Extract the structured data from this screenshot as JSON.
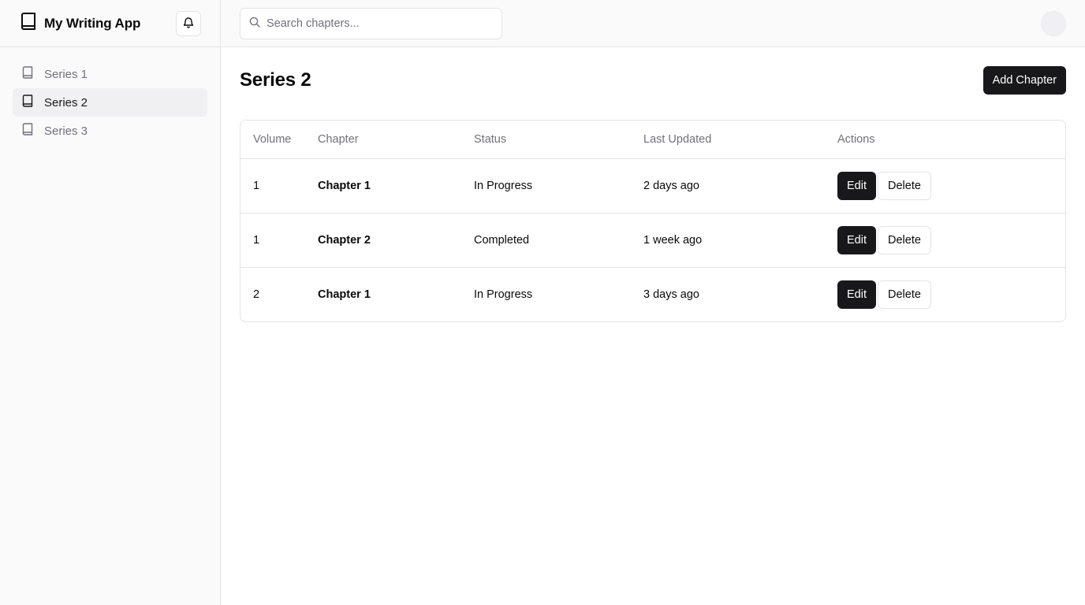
{
  "app": {
    "title": "My Writing App",
    "logo_icon": "book-icon",
    "notification_icon": "bell-icon"
  },
  "sidebar": {
    "items": [
      {
        "label": "Series 1",
        "icon": "book-icon",
        "active": false
      },
      {
        "label": "Series 2",
        "icon": "book-icon",
        "active": true
      },
      {
        "label": "Series 3",
        "icon": "book-icon",
        "active": false
      }
    ]
  },
  "search": {
    "placeholder": "Search chapters...",
    "value": "",
    "icon": "search-icon"
  },
  "main": {
    "title": "Series 2",
    "add_button": "Add Chapter"
  },
  "table": {
    "headers": {
      "volume": "Volume",
      "chapter": "Chapter",
      "status": "Status",
      "updated": "Last Updated",
      "actions": "Actions"
    },
    "rows": [
      {
        "volume": "1",
        "chapter": "Chapter 1",
        "status": "In Progress",
        "updated": "2 days ago",
        "edit": "Edit",
        "delete": "Delete"
      },
      {
        "volume": "1",
        "chapter": "Chapter 2",
        "status": "Completed",
        "updated": "1 week ago",
        "edit": "Edit",
        "delete": "Delete"
      },
      {
        "volume": "2",
        "chapter": "Chapter 1",
        "status": "In Progress",
        "updated": "3 days ago",
        "edit": "Edit",
        "delete": "Delete"
      }
    ]
  },
  "colors": {
    "primary": "#18181b",
    "muted_text": "#71717a",
    "border": "#e4e4e7",
    "sidebar_bg": "#fafafa",
    "active_item_bg": "#f0f0f2"
  }
}
